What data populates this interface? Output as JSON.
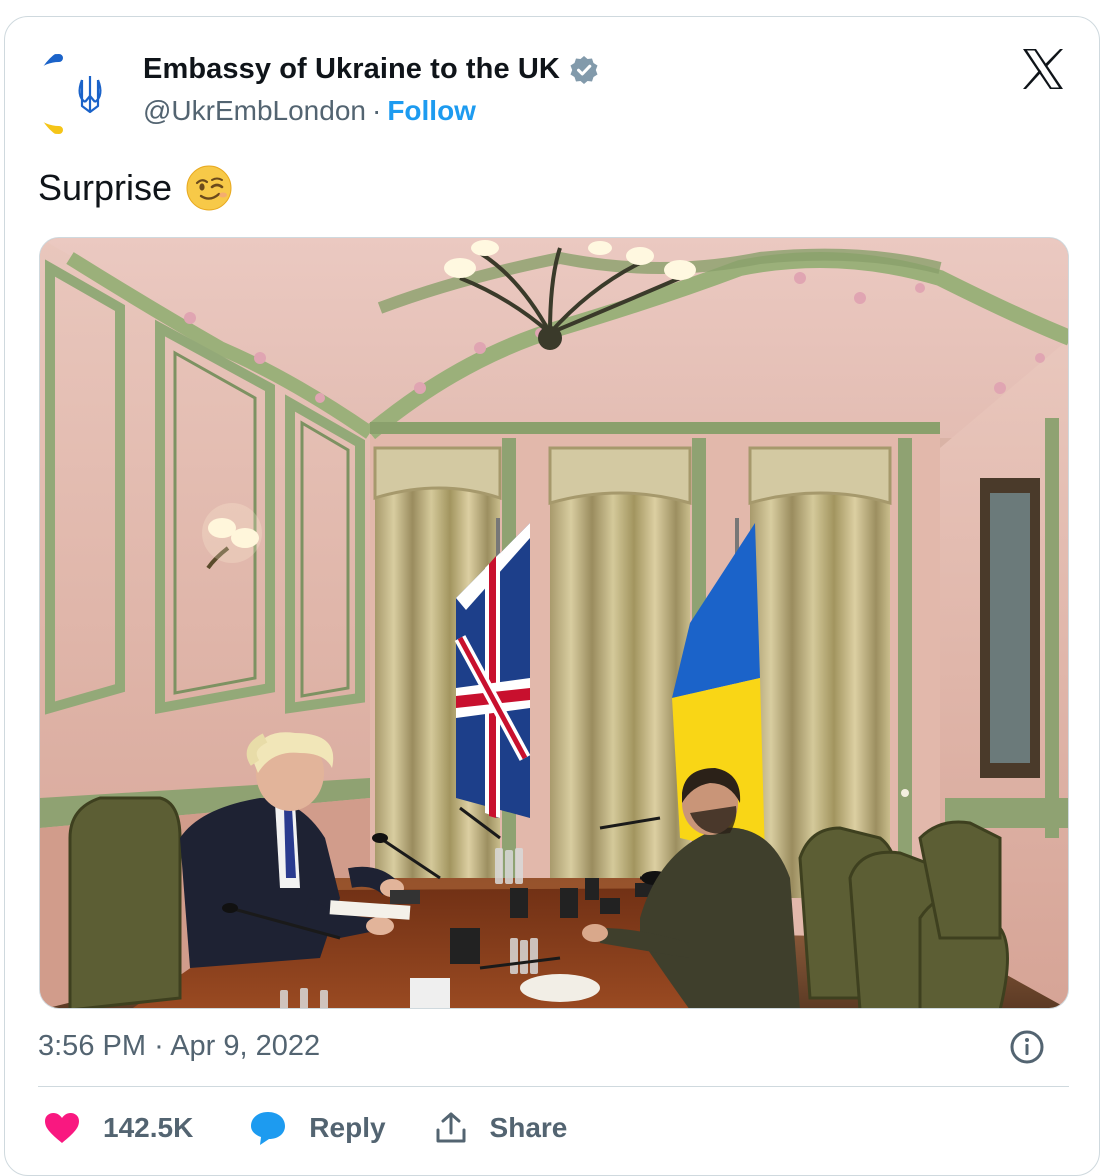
{
  "account": {
    "name": "Embassy of Ukraine to the UK",
    "handle": "@UkrEmbLondon",
    "separator": "·",
    "follow_label": "Follow",
    "verified": true
  },
  "tweet": {
    "text": "Surprise",
    "emoji": "winking-face",
    "time": "3:56 PM",
    "date_separator": "·",
    "date": "Apr 9, 2022"
  },
  "media": {
    "subject": "photo-meeting-room-with-flags"
  },
  "actions": {
    "likes_count": "142.5K",
    "reply_label": "Reply",
    "share_label": "Share"
  },
  "colors": {
    "accent": "#1d9bf0",
    "heart": "#f91880",
    "reply_bubble": "#1d9bf0",
    "verified_badge": "#829aab",
    "ukraine_blue": "#1b63c9",
    "ukraine_yellow": "#f9d616"
  }
}
